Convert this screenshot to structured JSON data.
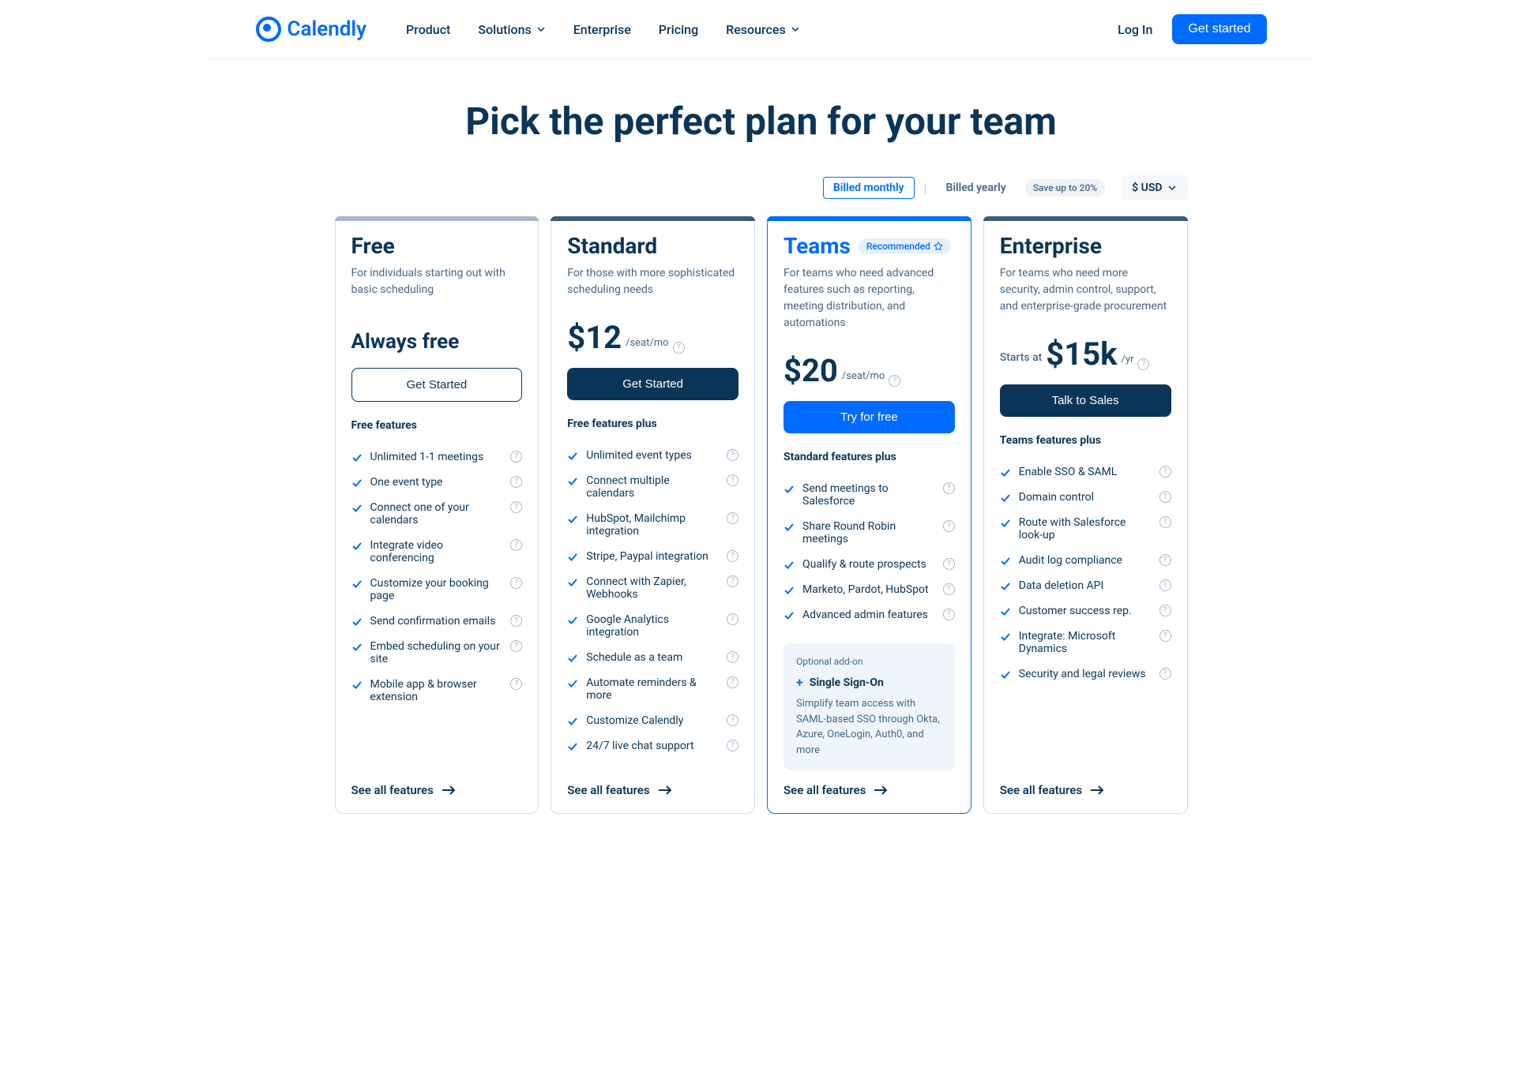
{
  "nav": {
    "logo_text": "Calendly",
    "menu": [
      "Product",
      "Solutions",
      "Enterprise",
      "Pricing",
      "Resources"
    ],
    "login": "Log In",
    "cta": "Get started"
  },
  "page_title": "Pick the perfect plan for your team",
  "billing": {
    "monthly": "Billed monthly",
    "yearly": "Billed yearly",
    "save_badge": "Save up to 20%",
    "currency": "$ USD"
  },
  "plans": [
    {
      "name": "Free",
      "desc": "For individuals starting out with basic scheduling",
      "price_text": "Always free",
      "cta": "Get Started",
      "features_title": "Free features",
      "features": [
        "Unlimited 1-1 meetings",
        "One event type",
        "Connect one of your calendars",
        "Integrate video conferencing",
        "Customize your booking page",
        "Send confirmation emails",
        "Embed scheduling on your site",
        "Mobile app & browser extension"
      ],
      "see_all": "See all features"
    },
    {
      "name": "Standard",
      "desc": "For those with more sophisticated scheduling needs",
      "price_amount": "$12",
      "price_unit": "/seat/mo",
      "cta": "Get Started",
      "features_title": "Free features plus",
      "features": [
        "Unlimited event types",
        "Connect multiple calendars",
        "HubSpot, Mailchimp integration",
        "Stripe, Paypal integration",
        "Connect with Zapier, Webhooks",
        "Google Analytics integration",
        "Schedule as a team",
        "Automate reminders & more",
        "Customize Calendly",
        "24/7 live chat support"
      ],
      "see_all": "See all features"
    },
    {
      "name": "Teams",
      "badge": "Recommended",
      "desc": "For teams who need advanced features such as reporting, meeting distribution, and automations",
      "price_amount": "$20",
      "price_unit": "/seat/mo",
      "cta": "Try for free",
      "features_title": "Standard features plus",
      "features": [
        "Send meetings to Salesforce",
        "Share Round Robin meetings",
        "Qualify & route prospects",
        "Marketo, Pardot, HubSpot",
        "Advanced admin features"
      ],
      "addon": {
        "label": "Optional add-on",
        "title": "Single Sign-On",
        "desc": "Simplify team access with SAML-based SSO through Okta, Azure, OneLogin, Auth0, and more"
      },
      "see_all": "See all features"
    },
    {
      "name": "Enterprise",
      "desc": "For teams who need more security, admin control, support, and enterprise-grade procurement",
      "price_prefix": "Starts at",
      "price_amount": "$15k",
      "price_unit": "/yr",
      "cta": "Talk to Sales",
      "features_title": "Teams features plus",
      "features": [
        "Enable SSO & SAML",
        "Domain control",
        "Route with Salesforce look-up",
        "Audit log compliance",
        "Data deletion API",
        "Customer success rep.",
        "Integrate: Microsoft Dynamics",
        "Security and legal reviews"
      ],
      "see_all": "See all features"
    }
  ]
}
